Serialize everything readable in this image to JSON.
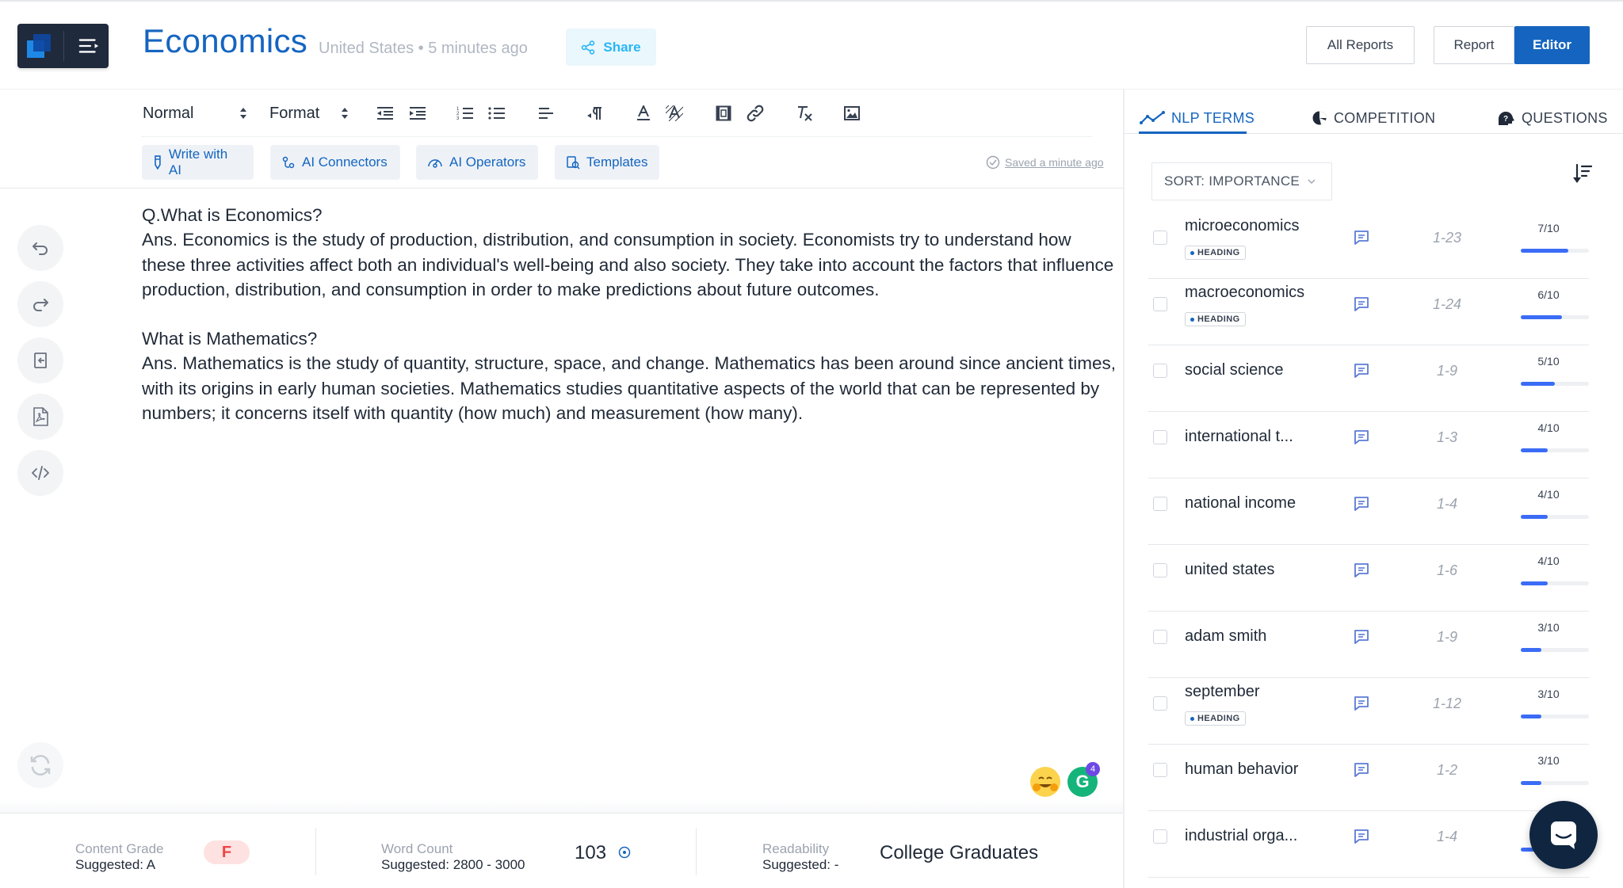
{
  "header": {
    "title": "Economics",
    "location": "United States",
    "separator": "•",
    "updated": "5 minutes ago",
    "share_label": "Share",
    "all_reports_label": "All Reports",
    "report_label": "Report",
    "editor_label": "Editor"
  },
  "toolbar": {
    "block_style": "Normal",
    "format": "Format",
    "ai_buttons": [
      "Write with AI",
      "AI Connectors",
      "AI Operators",
      "Templates"
    ],
    "saved_status": "Saved a minute ago"
  },
  "document": {
    "q1": "Q.What is Economics?",
    "a1": "Ans. Economics is the study of production, distribution, and consumption in society. Economists try to understand how these three activities affect both an individual's well-being and also society. They take into account the factors that influence production, distribution, and consumption in order to make predictions about future outcomes.",
    "q2": "What is Mathematics?",
    "a2": "Ans. Mathematics is the study of quantity, structure, space, and change. Mathematics has been around since ancient times, with its origins in early human societies. Mathematics studies quantitative aspects of the world that can be represented by numbers; it concerns itself with quantity (how much) and measurement (how many)."
  },
  "bottom_bar": {
    "content_grade_label": "Content Grade",
    "content_grade_suggested": "Suggested: A",
    "content_grade_value": "F",
    "word_count_label": "Word Count",
    "word_count_suggested": "Suggested: 2800 - 3000",
    "word_count_value": "103",
    "readability_label": "Readability",
    "readability_suggested": "Suggested: -",
    "readability_value": "College Graduates"
  },
  "grammarly_count": "4",
  "right_panel": {
    "tabs": [
      "NLP TERMS",
      "COMPETITION",
      "QUESTIONS"
    ],
    "sort_label": "SORT: IMPORTANCE",
    "heading_badge": "HEADING",
    "terms": [
      {
        "name": "microeconomics",
        "heading": true,
        "range": "1-23",
        "score": "7/10",
        "level": 0.7
      },
      {
        "name": "macroeconomics",
        "heading": true,
        "range": "1-24",
        "score": "6/10",
        "level": 0.6
      },
      {
        "name": "social science",
        "heading": false,
        "range": "1-9",
        "score": "5/10",
        "level": 0.5
      },
      {
        "name": "international t...",
        "heading": false,
        "range": "1-3",
        "score": "4/10",
        "level": 0.4
      },
      {
        "name": "national income",
        "heading": false,
        "range": "1-4",
        "score": "4/10",
        "level": 0.4
      },
      {
        "name": "united states",
        "heading": false,
        "range": "1-6",
        "score": "4/10",
        "level": 0.4
      },
      {
        "name": "adam smith",
        "heading": false,
        "range": "1-9",
        "score": "3/10",
        "level": 0.3
      },
      {
        "name": "september",
        "heading": true,
        "range": "1-12",
        "score": "3/10",
        "level": 0.3
      },
      {
        "name": "human behavior",
        "heading": false,
        "range": "1-2",
        "score": "3/10",
        "level": 0.3
      },
      {
        "name": "industrial orga...",
        "heading": false,
        "range": "1-4",
        "score": "",
        "level": 0.3
      }
    ]
  },
  "colors": {
    "brand": "#1565c0",
    "accent": "#3b6cf6",
    "grade_bad": "#ef4444"
  }
}
